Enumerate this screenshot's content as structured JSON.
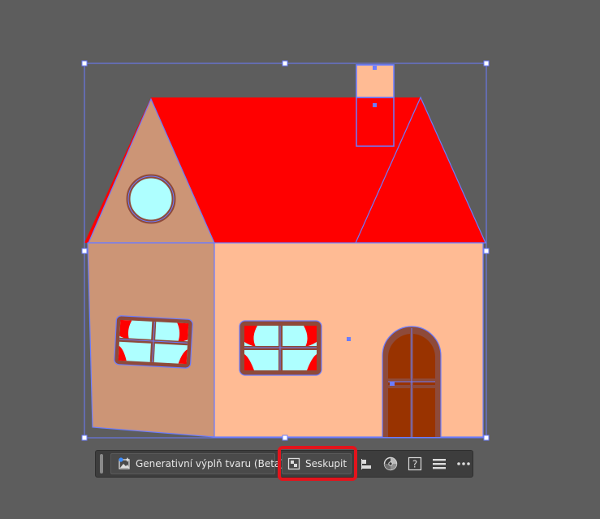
{
  "context_toolbar": {
    "generative_fill_label": "Generativní výplň tvaru (Beta)",
    "group_label": "Seskupit",
    "help_glyph": "?",
    "icons": [
      "generative-fill-icon",
      "group-icon",
      "align-icon",
      "recolor-icon",
      "help-icon",
      "properties-menu-icon",
      "more-options-icon"
    ]
  },
  "artwork": {
    "description_colors": {
      "roof": "#ff0000",
      "gable": "#cc9576",
      "wall": "#ffbb94",
      "window_glass": "#aeffff",
      "window_frame": "#8e4a3a",
      "door": "#993300",
      "selection": "#5a7bff"
    }
  },
  "annotation": {
    "highlight_color": "#e3141c"
  }
}
